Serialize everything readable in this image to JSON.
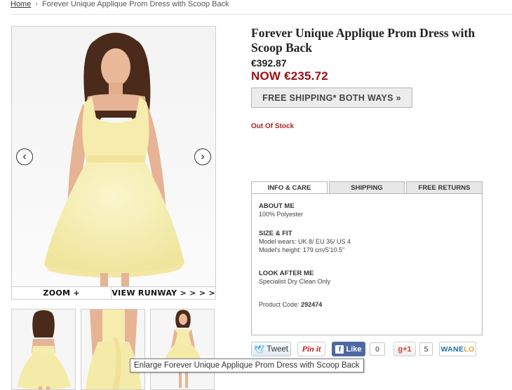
{
  "breadcrumb": {
    "home": "Home",
    "separator": "›",
    "current": "Forever Unique Applique Prom Dress with Scoop Back"
  },
  "gallery": {
    "prev_icon": "chevron-left-icon",
    "next_icon": "chevron-right-icon",
    "zoom_label": "ZOOM +",
    "runway_label": "VIEW RUNWAY > > > >",
    "tooltip": "Enlarge Forever Unique Applique Prom Dress with Scoop Back"
  },
  "product": {
    "title": "Forever Unique Applique Prom Dress with Scoop Back",
    "old_price": "€392.87",
    "now_price": "NOW €235.72",
    "shipping_button": "FREE SHIPPING* BOTH WAYS  »",
    "stock_status": "Out Of Stock"
  },
  "tabs": [
    {
      "label": "INFO & CARE",
      "active": true
    },
    {
      "label": "SHIPPING",
      "active": false
    },
    {
      "label": "FREE RETURNS",
      "active": false
    }
  ],
  "info": {
    "about_heading": "ABOUT ME",
    "about_text": "100% Polyester",
    "size_heading": "SIZE & FIT",
    "size_line1": "Model wears: UK 8/ EU 36/ US 4",
    "size_line2": "Model's height: 179 cm/5'10.5\"",
    "care_heading": "LOOK AFTER ME",
    "care_text": "Specialist Dry Clean Only",
    "code_label": "Product Code:",
    "code_value": "292474"
  },
  "share": {
    "tweet": "Tweet",
    "pinit": "Pin it",
    "like": "Like",
    "like_count": "0",
    "gplus": "g+1",
    "gplus_count": "5",
    "wanelo_a": "WANE",
    "wanelo_b": "LO"
  },
  "colors": {
    "price_now": "#9b0e14",
    "stock": "#b22222",
    "dress": "#f7f0b4",
    "facebook": "#4e69a2",
    "twitter": "#2aa3e6"
  }
}
